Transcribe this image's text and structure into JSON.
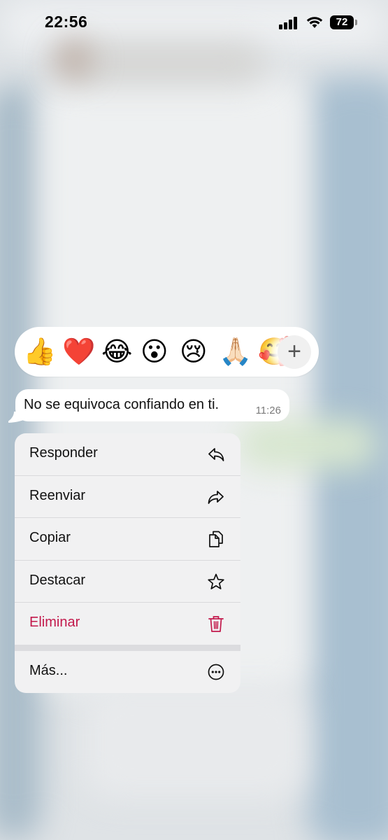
{
  "status": {
    "time": "22:56",
    "battery": "72"
  },
  "reactions": {
    "emojis": [
      "👍",
      "❤️",
      "😂",
      "😮",
      "😢",
      "🙏🏻",
      "🥰"
    ],
    "add_label": "+"
  },
  "message": {
    "text": "No se equivoca confiando en ti.",
    "time": "11:26"
  },
  "menu": {
    "items": [
      {
        "label": "Responder",
        "icon": "reply-icon"
      },
      {
        "label": "Reenviar",
        "icon": "forward-icon"
      },
      {
        "label": "Copiar",
        "icon": "copy-icon"
      },
      {
        "label": "Destacar",
        "icon": "star-icon"
      },
      {
        "label": "Eliminar",
        "icon": "trash-icon",
        "color": "#c2184b"
      },
      {
        "label": "Más...",
        "icon": "more-icon"
      }
    ]
  }
}
